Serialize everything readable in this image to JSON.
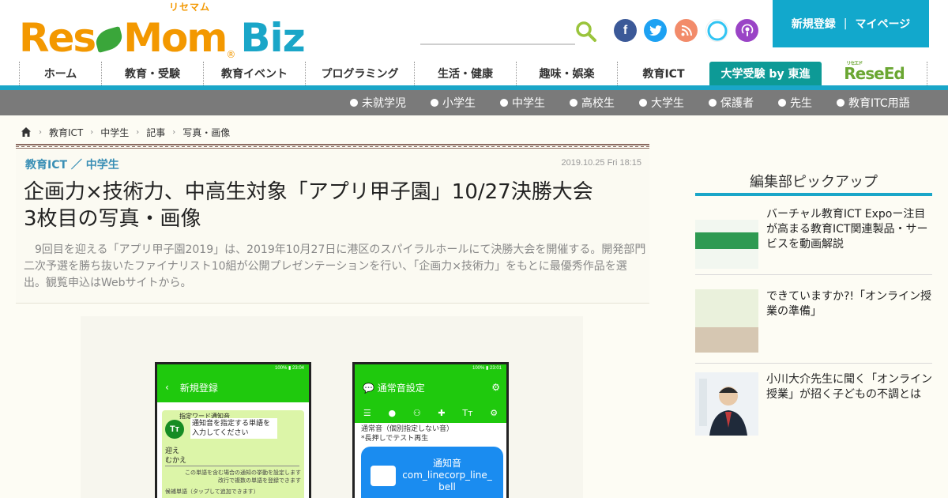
{
  "brand": {
    "logo_main": "ResMom",
    "logo_kana": "リセマム",
    "logo_biz": "Biz",
    "registered": "®",
    "accent": "#f39800",
    "biz_color": "#1aa6c8",
    "leaf_color": "#3aa63a"
  },
  "header": {
    "social": [
      {
        "name": "facebook",
        "glyph": "f",
        "color": "#3b5998"
      },
      {
        "name": "twitter",
        "glyph": "t",
        "color": "#1da1f2"
      },
      {
        "name": "rss",
        "glyph": "r",
        "color": "#f28b6a"
      },
      {
        "name": "alexa",
        "glyph": "o",
        "color": "#31c4f3"
      },
      {
        "name": "podcast",
        "glyph": "p",
        "color": "#9a44c6"
      }
    ],
    "member_register": "新規登録",
    "member_sep": "|",
    "member_mypage": "マイページ"
  },
  "nav": {
    "items": [
      "ホーム",
      "教育・受験",
      "教育イベント",
      "プログラミング",
      "生活・健康",
      "趣味・娯楽",
      "教育ICT",
      "大学受験 by 東進"
    ],
    "resed_logo": "ReseEd",
    "resed_small": "リセエド"
  },
  "subnav": {
    "items": [
      "未就学児",
      "小学生",
      "中学生",
      "高校生",
      "大学生",
      "保護者",
      "先生",
      "教育ITC用語"
    ]
  },
  "breadcrumb": [
    "教育ICT",
    "中学生",
    "記事",
    "写真・画像"
  ],
  "article": {
    "category": "教育ICT ／ 中学生",
    "date": "2019.10.25 Fri 18:15",
    "title_line1": "企画力×技術力、中高生対象「アプリ甲子園」10/27決勝大会",
    "title_line2": "3枚目の写真・画像",
    "lead": "9回目を迎える「アプリ甲子園2019」は、2019年10月27日に港区のスパイラルホールにて決勝大会を開催する。開発部門二次予選を勝ち抜いたファイナリスト10組が公開プレゼンテーションを行い、「企画力×技術力」をもとに最優秀作品を選出。観覧申込はWebサイトから。"
  },
  "photo": {
    "left_status": "100% ▮ 23:04",
    "left_header": "新規登録",
    "left_card_label": "指定ワード通知音",
    "left_card_desc": "通知音を指定する単語を入力してください",
    "left_input_line1": "迎え",
    "left_input_line2": "むかえ",
    "left_note": "この単語を含む場合の通知の挙動を設定します 改行で複数の単語を登録できます",
    "left_candidates": "候補単語（タップして追加できます）",
    "right_status": "100% ▮ 23:01",
    "right_header": "通常音設定",
    "right_body_line1": "通常音（個別指定しない音）",
    "right_body_line2": "*長押しでテスト再生",
    "right_bubble_line1": "通知音",
    "right_bubble_line2": "com_linecorp_line_",
    "right_bubble_line3": "bell"
  },
  "sidebar": {
    "title": "編集部ピックアップ",
    "picks": [
      {
        "text": "バーチャル教育ICT Expoー注目が高まる教育ICT関連製品・サービスを動画解説"
      },
      {
        "text": "できていますか?!「オンライン授業の準備」"
      },
      {
        "text": "小川大介先生に聞く「オンライン授業」が招く子どもの不調とは"
      }
    ]
  }
}
